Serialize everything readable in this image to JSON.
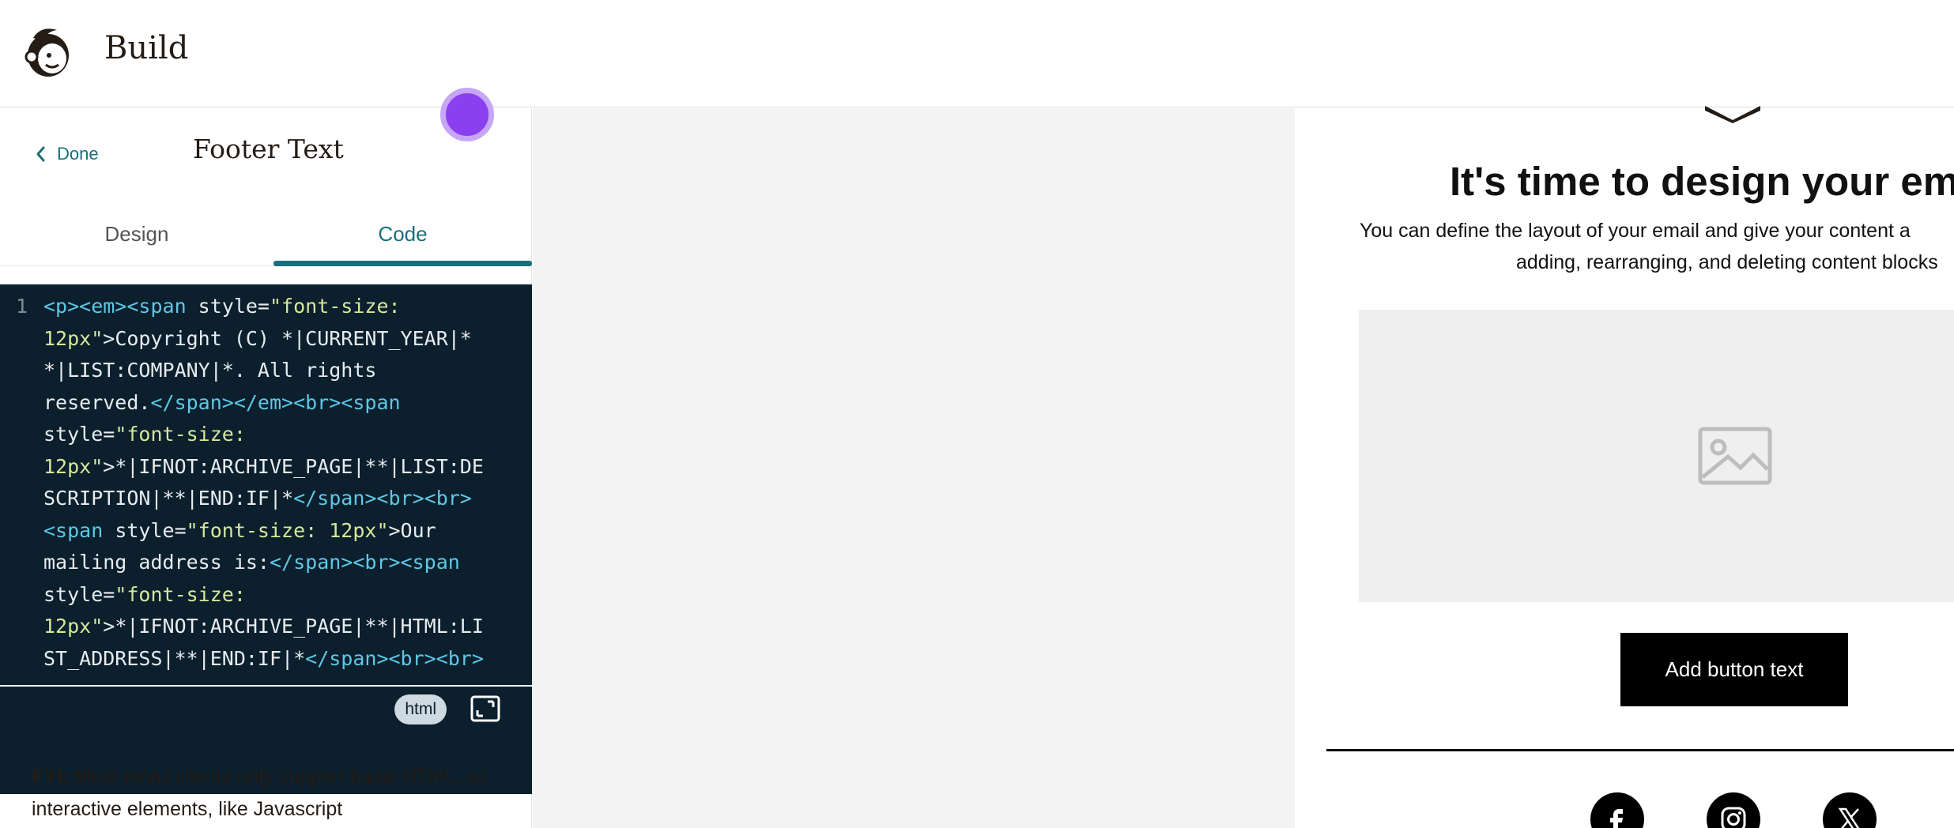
{
  "header": {
    "title": "Build",
    "logo_icon": "mailchimp-freddie-logo"
  },
  "panel": {
    "done_label": "Done",
    "title": "Footer Text",
    "tabs": [
      {
        "label": "Design",
        "active": false
      },
      {
        "label": "Code",
        "active": true
      }
    ],
    "accent_color": "#1a6f7a"
  },
  "editor": {
    "line_number": "1",
    "lines": [
      [
        {
          "t": "<p><em><span ",
          "c": "tag"
        },
        {
          "t": "style=",
          "c": "attr"
        },
        {
          "t": "\"font-size:",
          "c": "str"
        }
      ],
      [
        {
          "t": "12px\"",
          "c": "str"
        },
        {
          "t": ">Copyright (C) *|CURRENT_YEAR|*",
          "c": "txt"
        }
      ],
      [
        {
          "t": "*|LIST:COMPANY|*. All rights",
          "c": "txt"
        }
      ],
      [
        {
          "t": "reserved.",
          "c": "txt"
        },
        {
          "t": "</span></em><br><span",
          "c": "tag"
        }
      ],
      [
        {
          "t": "style=",
          "c": "attr"
        },
        {
          "t": "\"font-size:",
          "c": "str"
        }
      ],
      [
        {
          "t": "12px\"",
          "c": "str"
        },
        {
          "t": ">*|IFNOT:ARCHIVE_PAGE|**|LIST:DE",
          "c": "txt"
        }
      ],
      [
        {
          "t": "SCRIPTION|**|END:IF|*",
          "c": "txt"
        },
        {
          "t": "</span><br><br>",
          "c": "tag"
        }
      ],
      [
        {
          "t": "<span ",
          "c": "tag"
        },
        {
          "t": "style=",
          "c": "attr"
        },
        {
          "t": "\"font-size: 12px\"",
          "c": "str"
        },
        {
          "t": ">Our",
          "c": "txt"
        }
      ],
      [
        {
          "t": "mailing address is:",
          "c": "txt"
        },
        {
          "t": "</span><br><span",
          "c": "tag"
        }
      ],
      [
        {
          "t": "style=",
          "c": "attr"
        },
        {
          "t": "\"font-size:",
          "c": "str"
        }
      ],
      [
        {
          "t": "12px\"",
          "c": "str"
        },
        {
          "t": ">*|IFNOT:ARCHIVE_PAGE|**|HTML:LI",
          "c": "txt"
        }
      ],
      [
        {
          "t": "ST_ADDRESS|**|END:IF|*",
          "c": "txt"
        },
        {
          "t": "</span><br><br>",
          "c": "tag"
        }
      ]
    ],
    "syntax_colors": {
      "tag": "#5ec8e5",
      "attr": "#e8ecef",
      "str": "#d7e89a",
      "txt": "#e8ecef"
    },
    "language": "html",
    "expand_icon": "expand-icon"
  },
  "fyi": {
    "label": "FYI:",
    "text": " Most email clients only support basic HTML, so interactive elements, like Javascript"
  },
  "preview": {
    "heading": "It's time to design your em",
    "body_line1": "You can define the layout of your email and give your content a",
    "body_line2": "adding, rearranging, and deleting content blocks",
    "image_icon": "image-placeholder-icon",
    "button_label": "Add button text",
    "social": [
      {
        "name": "facebook-icon"
      },
      {
        "name": "instagram-icon"
      },
      {
        "name": "x-twitter-icon"
      }
    ]
  }
}
